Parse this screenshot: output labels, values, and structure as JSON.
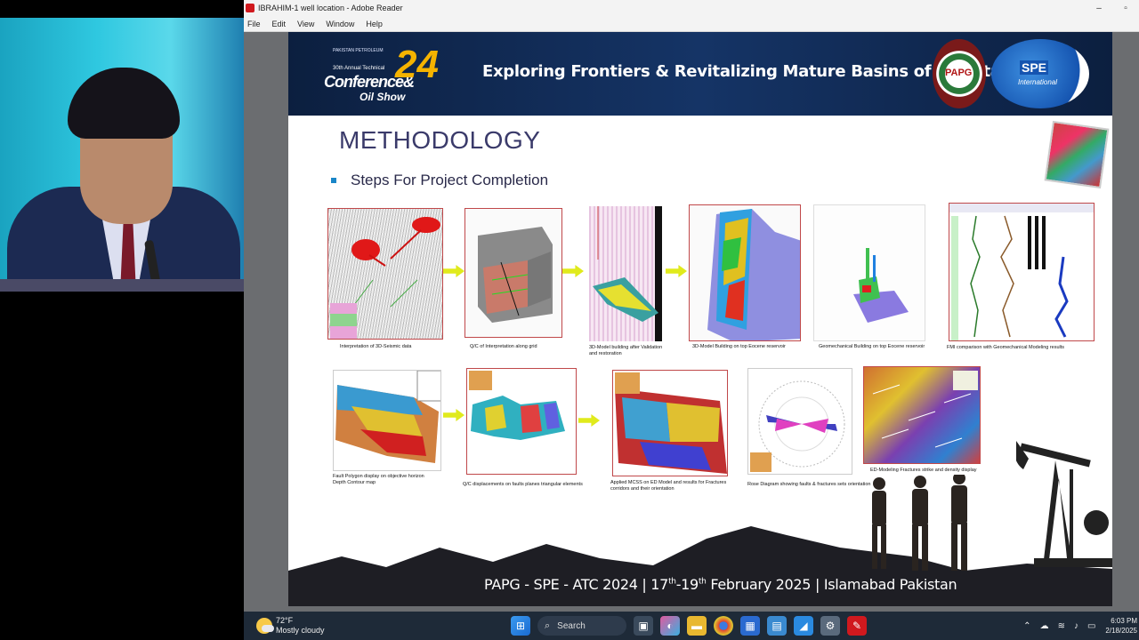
{
  "window": {
    "title": "IBRAHIM-1 well location - Adobe Reader",
    "minimize_glyph": "–",
    "maximize_glyph": "▫"
  },
  "menu": [
    {
      "label": "File"
    },
    {
      "label": "Edit"
    },
    {
      "label": "View"
    },
    {
      "label": "Window"
    },
    {
      "label": "Help"
    }
  ],
  "slide": {
    "banner": {
      "conf_small": "PAKISTAN PETROLEUM",
      "conf_annual": "30th Annual Technical",
      "conf_name": "Conference&",
      "conf_oil": "Oil Show",
      "conf_number": "24",
      "title": "Exploring Frontiers & Revitalizing Mature Basins of Pakistan",
      "papg": "PAPG",
      "spe": "SPE",
      "spe_sub": "International"
    },
    "title": "METHODOLOGY",
    "bullet": "Steps For Project Completion",
    "row1": [
      {
        "caption": "Interpretation of 3D-Seismic data"
      },
      {
        "caption": "Q/C of Interpretation along grid"
      },
      {
        "caption": "3D-Model building after Validation",
        "caption2": "and restoration"
      },
      {
        "caption": "3D-Model Building on top Eocene reservoir"
      },
      {
        "caption": "Geomechanical Building on top Eocene reservoir"
      },
      {
        "caption": "FMI comparison with Geomechanical Modeling results"
      }
    ],
    "row2": [
      {
        "caption": "Fault Polygon display on objective horizon",
        "caption2": "Depth Contour map"
      },
      {
        "caption": "Q/C displacements on faults planes triangular elements"
      },
      {
        "caption": "Applied MCSS on ED Model and results for Fractures",
        "caption2": "corridors and their orientation"
      },
      {
        "caption": "Rose Diagram showing faults & fractures sets orientation"
      },
      {
        "caption": "ED-Modeling Fractures strike and density display"
      }
    ],
    "footer": {
      "prefix": "PAPG - SPE - ATC 2024 | 17",
      "sup1": "th",
      "mid": "-19",
      "sup2": "th",
      "suffix": " February 2025 | Islamabad Pakistan"
    }
  },
  "taskbar": {
    "temperature": "72°F",
    "condition": "Mostly cloudy",
    "search_label": "Search",
    "time": "6:03 PM",
    "date": "2/18/2025"
  }
}
